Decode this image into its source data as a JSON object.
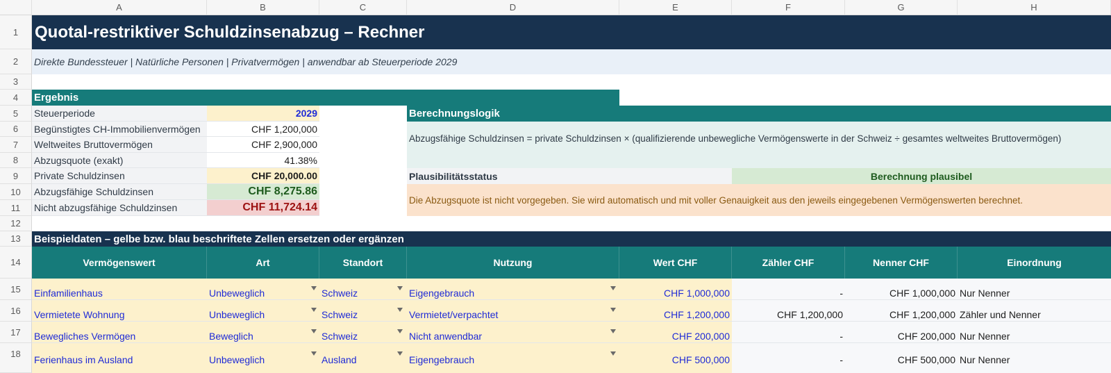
{
  "columns": [
    "A",
    "B",
    "C",
    "D",
    "E",
    "F",
    "G",
    "H"
  ],
  "rows": [
    "1",
    "2",
    "3",
    "4",
    "5",
    "6",
    "7",
    "8",
    "9",
    "10",
    "11",
    "12",
    "13",
    "14",
    "15",
    "16",
    "17",
    "18"
  ],
  "title": "Quotal-restriktiver Schuldzinsenabzug – Rechner",
  "subtitle": "Direkte Bundessteuer | Natürliche Personen | Privatvermögen | anwendbar ab Steuerperiode 2029",
  "ergebnis": {
    "header": "Ergebnis",
    "rows": [
      {
        "label": "Steuerperiode",
        "value": "2029"
      },
      {
        "label": "Begünstigtes CH-Immobilienvermögen",
        "value": "CHF 1,200,000"
      },
      {
        "label": "Weltweites Bruttovermögen",
        "value": "CHF 2,900,000"
      },
      {
        "label": "Abzugsquote (exakt)",
        "value": "41.38%"
      },
      {
        "label": "Private Schuldzinsen",
        "value": "CHF 20,000.00"
      },
      {
        "label": "Abzugsfähige Schuldzinsen",
        "value": "CHF 8,275.86"
      },
      {
        "label": "Nicht abzugsfähige Schuldzinsen",
        "value": "CHF 11,724.14"
      }
    ]
  },
  "logik": {
    "header": "Berechnungslogik",
    "formula": "Abzugsfähige Schuldzinsen = private Schuldzinsen × (qualifizierende unbewegliche Vermögenswerte in der Schweiz ÷ gesamtes weltweites Bruttovermögen)",
    "status_label": "Plausibilitätsstatus",
    "status_value": "Berechnung plausibel",
    "note": "Die Abzugsquote ist nicht vorgegeben. Sie wird automatisch und mit voller Genauigkeit aus den jeweils eingegebenen Vermögenswerten berechnet."
  },
  "beispiel": {
    "header": "Beispieldaten – gelbe bzw. blau beschriftete Zellen ersetzen oder ergänzen",
    "columns": [
      "Vermögenswert",
      "Art",
      "Standort",
      "Nutzung",
      "Wert CHF",
      "Zähler CHF",
      "Nenner CHF",
      "Einordnung"
    ],
    "rows": [
      [
        "Einfamilienhaus",
        "Unbeweglich",
        "Schweiz",
        "Eigengebrauch",
        "CHF 1,000,000",
        "-",
        "CHF 1,000,000",
        "Nur Nenner"
      ],
      [
        "Vermietete Wohnung",
        "Unbeweglich",
        "Schweiz",
        "Vermietet/verpachtet",
        "CHF 1,200,000",
        "CHF 1,200,000",
        "CHF 1,200,000",
        "Zähler und Nenner"
      ],
      [
        "Bewegliches Vermögen",
        "Beweglich",
        "Schweiz",
        "Nicht anwendbar",
        "CHF 200,000",
        "-",
        "CHF 200,000",
        "Nur Nenner"
      ],
      [
        "Ferienhaus im Ausland",
        "Unbeweglich",
        "Ausland",
        "Eigengebrauch",
        "CHF 500,000",
        "-",
        "CHF 500,000",
        "Nur Nenner"
      ]
    ]
  },
  "colors": {
    "navy": "#18324f",
    "teal": "#167b7a",
    "input_yellow": "#fdf1cc",
    "input_blue_text": "#1f2bd6",
    "green_fill": "#d6ead3",
    "green_text": "#1e5b1e",
    "red_fill": "#f3cfcf",
    "red_text": "#9c1111",
    "light_blue": "#e9f0f8",
    "light_teal": "#e5f1ef",
    "note_orange": "#fbe2cc",
    "note_text": "#8a5a12"
  }
}
